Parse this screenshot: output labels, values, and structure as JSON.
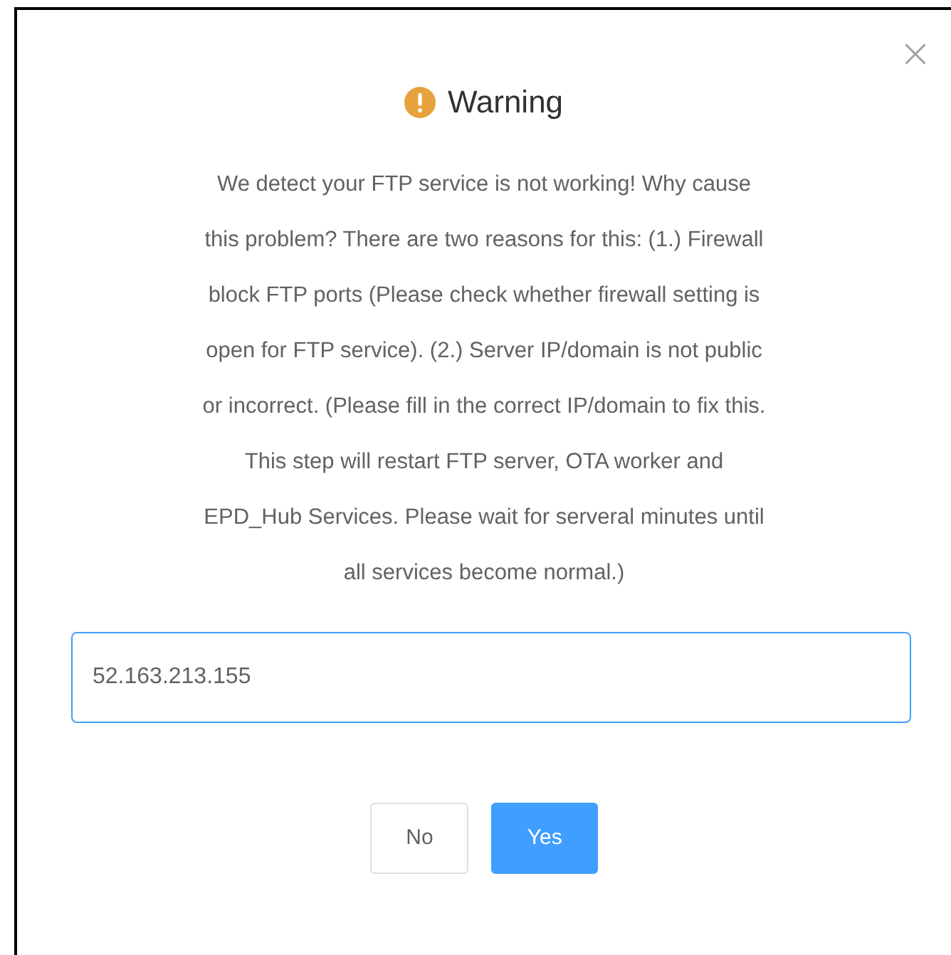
{
  "dialog": {
    "title": "Warning",
    "message_lines": [
      "We detect your FTP service is not working! Why cause",
      "this problem? There are two reasons for this: (1.) Firewall",
      "block FTP ports (Please check whether firewall setting is",
      "open for FTP service). (2.) Server IP/domain is not public",
      "or incorrect. (Please fill in the correct IP/domain to fix this.",
      "This step will restart FTP server, OTA worker and",
      "EPD_Hub Services. Please wait for serveral minutes until",
      "all services become normal.)"
    ],
    "input": {
      "value": "52.163.213.155",
      "focused": true
    },
    "buttons": [
      {
        "label": "No",
        "kind": "default"
      },
      {
        "label": "Yes",
        "kind": "primary"
      }
    ]
  }
}
